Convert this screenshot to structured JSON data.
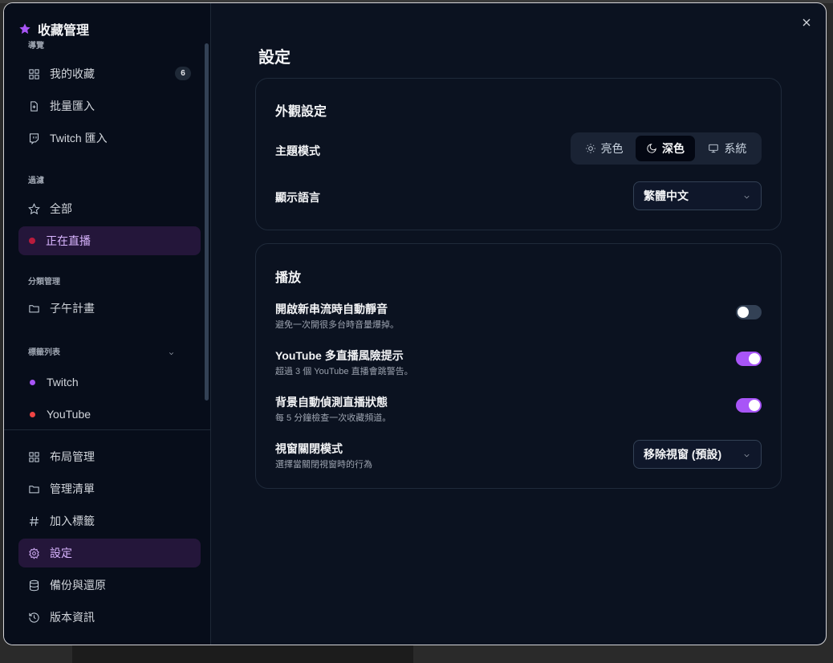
{
  "brand": {
    "title": "收藏管理",
    "icon": "star-icon"
  },
  "sidebar": {
    "sections": {
      "nav": "導覽",
      "filter": "過濾",
      "category": "分類管理",
      "tags": "標籤列表"
    },
    "nav_items": [
      {
        "label": "我的收藏",
        "icon": "grid-icon",
        "badge": "6"
      },
      {
        "label": "批量匯入",
        "icon": "file-import-icon"
      },
      {
        "label": "Twitch 匯入",
        "icon": "twitch-icon"
      }
    ],
    "filter_items": [
      {
        "label": "全部",
        "icon": "star-outline-icon"
      },
      {
        "label": "正在直播",
        "icon": "live-dot-icon",
        "active": true
      }
    ],
    "category_items": [
      {
        "label": "子午計畫",
        "icon": "folder-icon"
      }
    ],
    "tag_items": [
      {
        "label": "Twitch",
        "color": "#a855f7"
      },
      {
        "label": "YouTube",
        "color": "#ef4444"
      }
    ],
    "bottom_items": [
      {
        "label": "布局管理",
        "icon": "grid-icon"
      },
      {
        "label": "管理清單",
        "icon": "folder-icon"
      },
      {
        "label": "加入標籤",
        "icon": "hash-icon"
      },
      {
        "label": "設定",
        "icon": "gear-icon",
        "active": true
      },
      {
        "label": "備份與還原",
        "icon": "database-icon"
      },
      {
        "label": "版本資訊",
        "icon": "history-icon"
      }
    ]
  },
  "main": {
    "title": "設定",
    "appearance": {
      "title": "外觀設定",
      "theme_label": "主題模式",
      "theme_options": [
        "亮色",
        "深色",
        "系統"
      ],
      "theme_selected": "深色",
      "language_label": "顯示語言",
      "language_value": "繁體中文"
    },
    "playback": {
      "title": "播放",
      "mute": {
        "label": "開啟新串流時自動靜音",
        "desc": "避免一次開很多台時音量爆掉。",
        "on": false
      },
      "yt_warn": {
        "label": "YouTube 多直播風險提示",
        "desc": "超過 3 個 YouTube 直播會跳警告。",
        "on": true
      },
      "bg_detect": {
        "label": "背景自動偵測直播狀態",
        "desc": "每 5 分鐘檢查一次收藏頻道。",
        "on": true
      },
      "close_mode": {
        "label": "視窗關閉模式",
        "desc": "選擇當關閉視窗時的行為",
        "value": "移除視窗 (預設)"
      }
    }
  },
  "colors": {
    "accent": "#a855f7",
    "active_bg": "#24163a",
    "live": "#ef4444"
  }
}
